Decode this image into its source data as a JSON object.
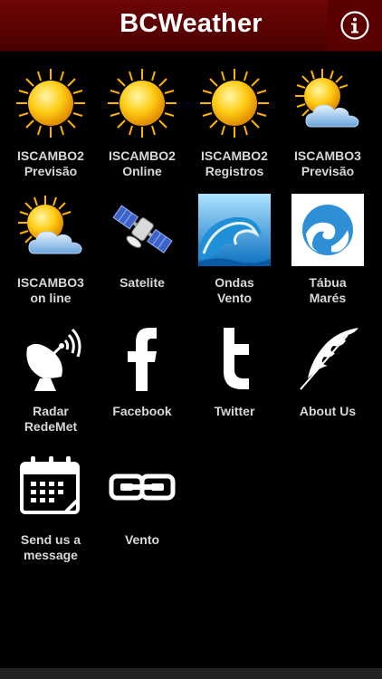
{
  "header": {
    "title": "BCWeather",
    "info_icon": "info-icon"
  },
  "tiles": [
    {
      "line1": "ISCAMBO2",
      "line2": "Previsão",
      "icon": "sun-icon"
    },
    {
      "line1": "ISCAMBO2",
      "line2": "Online",
      "icon": "sun-icon"
    },
    {
      "line1": "ISCAMBO2",
      "line2": "Registros",
      "icon": "sun-icon"
    },
    {
      "line1": "ISCAMBO3",
      "line2": "Previsão",
      "icon": "sun-cloud-icon"
    },
    {
      "line1": "ISCAMBO3",
      "line2": "on line",
      "icon": "sun-cloud-icon"
    },
    {
      "line1": "Satelite",
      "line2": "",
      "icon": "satellite-icon"
    },
    {
      "line1": "Ondas",
      "line2": "Vento",
      "icon": "wave-icon"
    },
    {
      "line1": "Tábua",
      "line2": "Marés",
      "icon": "tide-icon"
    },
    {
      "line1": "Radar",
      "line2": "RedeMet",
      "icon": "radar-dish-icon"
    },
    {
      "line1": "Facebook",
      "line2": "",
      "icon": "facebook-icon"
    },
    {
      "line1": "Twitter",
      "line2": "",
      "icon": "twitter-icon"
    },
    {
      "line1": "About Us",
      "line2": "",
      "icon": "feather-icon"
    },
    {
      "line1": "Send us a",
      "line2": "message",
      "icon": "calendar-icon"
    },
    {
      "line1": "Vento",
      "line2": "",
      "icon": "chain-link-icon"
    }
  ]
}
